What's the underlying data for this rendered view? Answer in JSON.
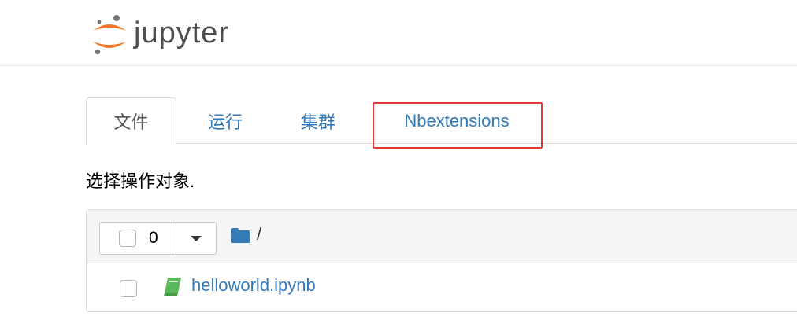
{
  "header": {
    "logo_text": "jupyter"
  },
  "tabs": [
    {
      "label": "文件",
      "active": true
    },
    {
      "label": "运行",
      "active": false
    },
    {
      "label": "集群",
      "active": false
    },
    {
      "label": "Nbextensions",
      "active": false,
      "highlighted": true
    }
  ],
  "instruction": "选择操作对象.",
  "list_header": {
    "selected_count": "0",
    "path": "/"
  },
  "files": [
    {
      "name": "helloworld.ipynb",
      "icon": "notebook-icon"
    }
  ],
  "colors": {
    "link": "#337ab7",
    "highlight_border": "#e03a3a",
    "logo_orange": "#f37726",
    "notebook_green": "#5cb85c"
  }
}
